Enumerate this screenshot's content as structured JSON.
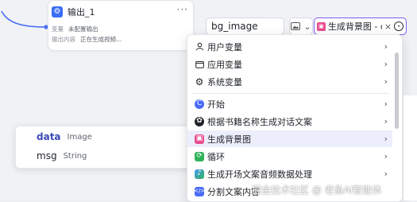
{
  "node": {
    "title": "输出_1",
    "row1_label": "变量",
    "row1_value": "未配置输出",
    "row2_label": "输出内容",
    "row2_value": "正在生成视频..."
  },
  "form": {
    "name_value": "bg_image",
    "type_icon": "image-icon",
    "value_label": "生成背景图 - d"
  },
  "output_vars": [
    {
      "name": "data",
      "type": "Image",
      "selected": true
    },
    {
      "name": "msg",
      "type": "String",
      "selected": false
    }
  ],
  "menu": {
    "items": [
      {
        "label": "用户变量",
        "icon": "user-icon"
      },
      {
        "label": "应用变量",
        "icon": "folder-icon"
      },
      {
        "label": "系统变量",
        "icon": "gear-icon"
      },
      {
        "label": "开始",
        "icon": "start-icon"
      },
      {
        "label": "根据书籍名称生成对话文案",
        "icon": "llm-icon"
      },
      {
        "label": "生成背景图",
        "icon": "image-gen-icon"
      },
      {
        "label": "循环",
        "icon": "loop-icon"
      },
      {
        "label": "生成开场文案音频数据处理",
        "icon": "audio-icon"
      },
      {
        "label": "分割文案内容",
        "icon": "code-icon"
      }
    ]
  },
  "watermark": "掘金技术社区 @ 老鱼AI智能体",
  "colors": {
    "accent": "#7b5cf5",
    "highlight": "#eceefc",
    "node_blue": "#3b6cf6",
    "pink": "#e94d8f"
  }
}
